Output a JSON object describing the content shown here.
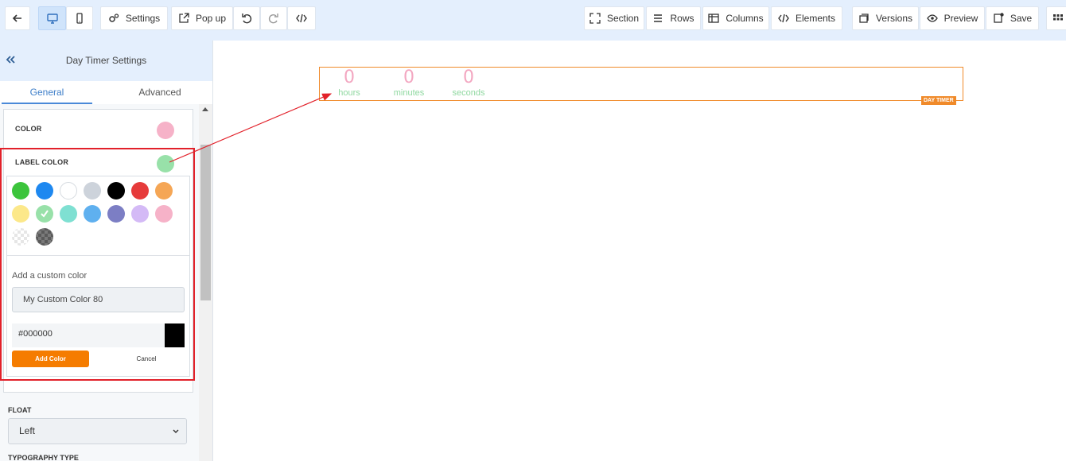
{
  "toolbar": {
    "settings": "Settings",
    "popup": "Pop up",
    "section": "Section",
    "rows": "Rows",
    "columns": "Columns",
    "elements": "Elements",
    "versions": "Versions",
    "preview": "Preview",
    "save": "Save"
  },
  "sidebar": {
    "title": "Day Timer Settings",
    "tabs": {
      "general": "General",
      "advanced": "Advanced"
    },
    "color_label": "COLOR",
    "label_color_label": "LABEL COLOR",
    "color_value": "#f6b2c8",
    "label_color_value": "#98e1a9",
    "picker": {
      "swatches": [
        "#3cc43c",
        "#1e88f0",
        "#ffffff",
        "#cdd3db",
        "#000000",
        "#e63b3b",
        "#f5a655",
        "#fce88a",
        "#98e1a9",
        "#7fe0d2",
        "#5fb0ef",
        "#7c7ec4",
        "#d4baf6",
        "#f6b2c8"
      ],
      "selected_index": 8,
      "custom_label": "Add a custom color",
      "custom_name": "My Custom Color 80",
      "hex": "#000000",
      "add_button": "Add Color",
      "cancel_button": "Cancel"
    },
    "float_label": "FLOAT",
    "float_value": "Left",
    "typography_label": "TYPOGRAPHY TYPE"
  },
  "canvas": {
    "timer": [
      {
        "value": "0",
        "label": "hours"
      },
      {
        "value": "0",
        "label": "minutes"
      },
      {
        "value": "0",
        "label": "seconds"
      }
    ],
    "tag": "DAY TIMER",
    "number_color": "#f3a7c1",
    "label_color": "#8fd8a0",
    "accent": "#f08a2a"
  }
}
